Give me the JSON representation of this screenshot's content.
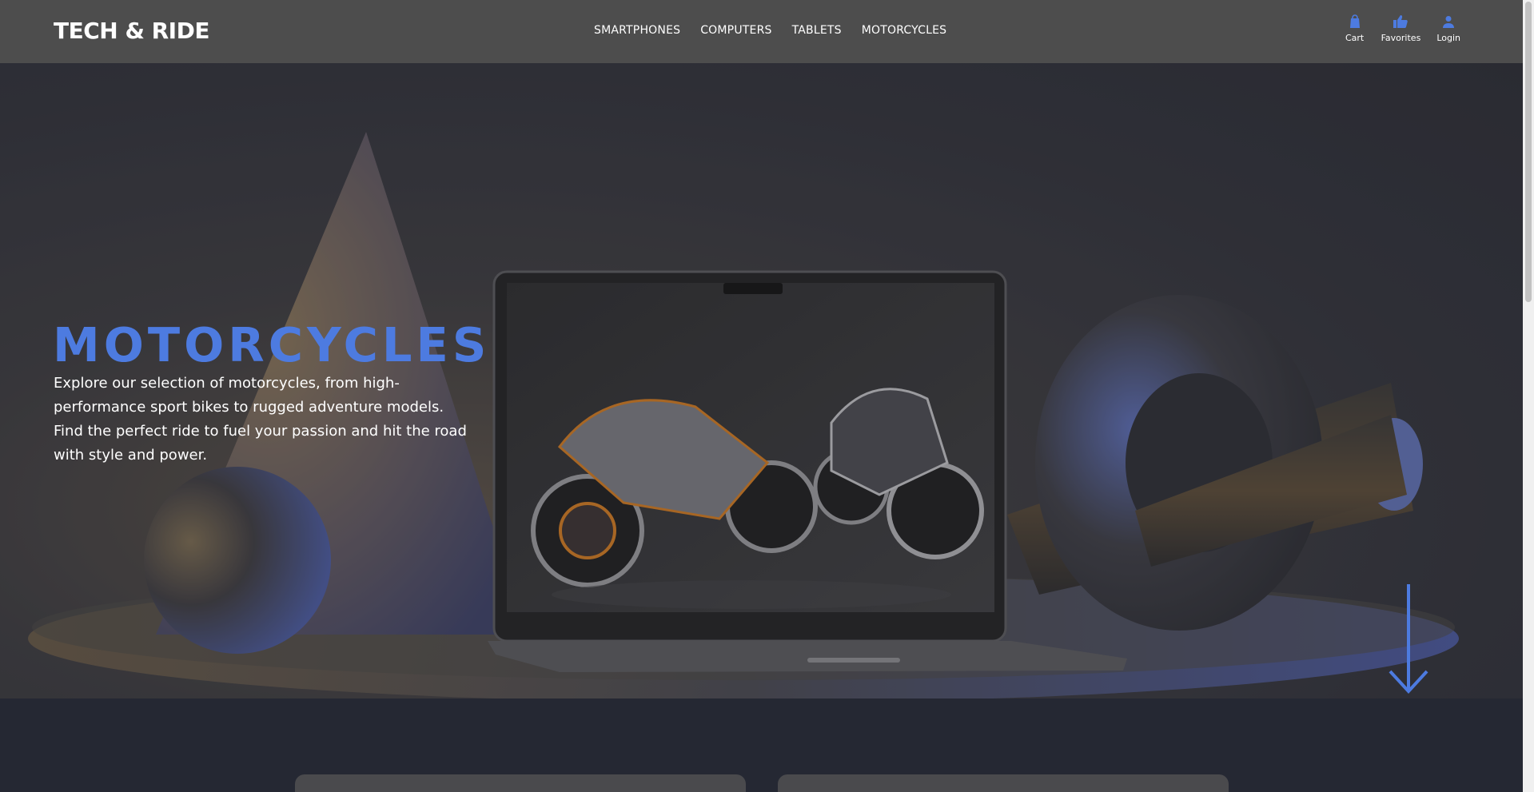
{
  "brand": {
    "logo": "TECH & RIDE"
  },
  "nav": {
    "items": [
      "SMARTPHONES",
      "COMPUTERS",
      "TABLETS",
      "MOTORCYCLES"
    ]
  },
  "actions": {
    "cart": "Cart",
    "favorites": "Favorites",
    "login": "Login"
  },
  "icons": {
    "cart": "shopping-bag-icon",
    "favorites": "thumbs-up-icon",
    "login": "user-icon",
    "scroll": "arrow-down-icon"
  },
  "hero": {
    "title": "MOTORCYCLES",
    "description": "Explore our selection of motorcycles, from high-performance sport bikes to rugged adventure models. Find the perfect ride to fuel your passion and hit the road with style and power."
  },
  "colors": {
    "accent": "#4d7be0",
    "header_bg": "#4d4d4d",
    "page_bg": "#252833"
  }
}
